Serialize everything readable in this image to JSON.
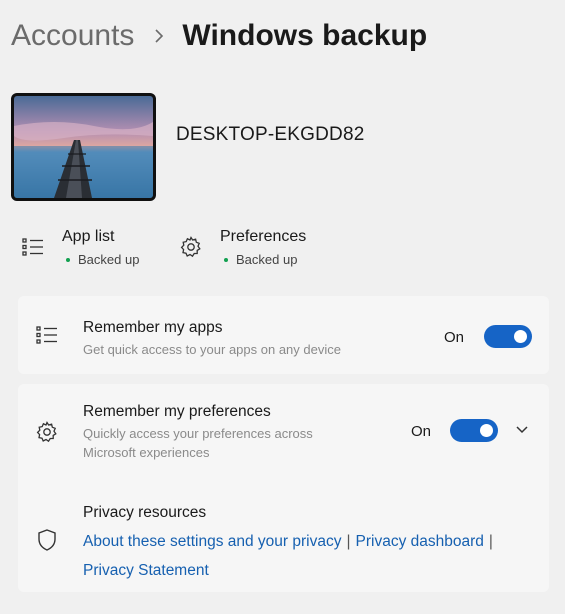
{
  "breadcrumb": {
    "parent": "Accounts",
    "current": "Windows backup"
  },
  "device": {
    "name": "DESKTOP-EKGDD82"
  },
  "backup_status": [
    {
      "title": "App list",
      "status": "Backed up",
      "icon": "list-icon"
    },
    {
      "title": "Preferences",
      "status": "Backed up",
      "icon": "gear-icon"
    }
  ],
  "remember_apps": {
    "title": "Remember my apps",
    "description": "Get quick access to your apps on any device",
    "toggle_label": "On",
    "toggle_on": true
  },
  "remember_prefs": {
    "title": "Remember my preferences",
    "description_line1": "Quickly access your preferences across",
    "description_line2": "Microsoft experiences",
    "toggle_label": "On",
    "toggle_on": true
  },
  "privacy": {
    "heading": "Privacy resources",
    "link_settings": "About these settings and your privacy",
    "link_dashboard": "Privacy dashboard",
    "link_statement": "Privacy Statement",
    "separator": "|"
  },
  "colors": {
    "accent": "#1664c6",
    "link": "#1660b0",
    "status_ok": "#12a050",
    "background": "#f0f0f0",
    "card": "#f6f6f6"
  }
}
